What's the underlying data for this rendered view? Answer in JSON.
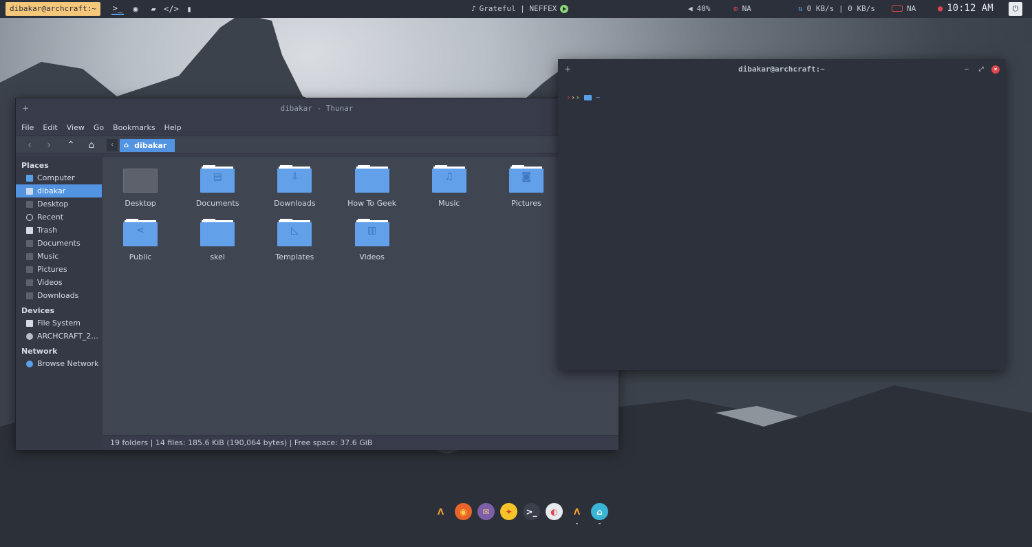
{
  "topbar": {
    "user": "dibakar@archcraft:~",
    "apps": [
      {
        "icon": "terminal-icon",
        "glyph": ">_"
      },
      {
        "icon": "firefox-icon",
        "glyph": "◉"
      },
      {
        "icon": "folder-open-icon",
        "glyph": "▰"
      },
      {
        "icon": "code-icon",
        "glyph": "</>"
      },
      {
        "icon": "book-icon",
        "glyph": "▮"
      }
    ],
    "music_note": "♪",
    "music": "Grateful | NEFFEX",
    "volume": "40%",
    "cpu": "NA",
    "network": "0 KB/s | 0 KB/s",
    "battery": "NA",
    "time": "10:12 AM"
  },
  "thunar": {
    "title": "dibakar - Thunar",
    "plus": "+",
    "menu": [
      "File",
      "Edit",
      "View",
      "Go",
      "Bookmarks",
      "Help"
    ],
    "path": "dibakar",
    "sidebar": {
      "places_heading": "Places",
      "places": [
        "Computer",
        "dibakar",
        "Desktop",
        "Recent",
        "Trash",
        "Documents",
        "Music",
        "Pictures",
        "Videos",
        "Downloads"
      ],
      "devices_heading": "Devices",
      "devices": [
        "File System",
        "ARCHCRAFT_2..."
      ],
      "network_heading": "Network",
      "network": [
        "Browse Network"
      ]
    },
    "folders": [
      {
        "name": "Desktop",
        "glyph": ""
      },
      {
        "name": "Documents",
        "glyph": "▤"
      },
      {
        "name": "Downloads",
        "glyph": "⇩"
      },
      {
        "name": "How To Geek",
        "glyph": ""
      },
      {
        "name": "Music",
        "glyph": "♫"
      },
      {
        "name": "Pictures",
        "glyph": "◙"
      },
      {
        "name": "Public",
        "glyph": "⋖"
      },
      {
        "name": "skel",
        "glyph": ""
      },
      {
        "name": "Templates",
        "glyph": "◺"
      },
      {
        "name": "Videos",
        "glyph": "▥"
      }
    ],
    "status": "19 folders  |  14 files: 185.6 KiB (190,064 bytes)  |  Free space: 37.6 GiB"
  },
  "terminal": {
    "title": "dibakar@archcraft:~",
    "plus": "+",
    "prompt_arrows": ">>>",
    "prompt_dir": "~"
  },
  "dock": [
    {
      "icon": "archcraft-icon",
      "glyph": "Λ",
      "bg": "#2b303a",
      "fg": "#f4a02a",
      "running": false
    },
    {
      "icon": "firefox-icon",
      "glyph": "◉",
      "bg": "#e8642b",
      "fg": "#ffd24a",
      "running": false
    },
    {
      "icon": "mail-icon",
      "glyph": "✉",
      "bg": "#7c5fa8",
      "fg": "#f4c77b",
      "running": false
    },
    {
      "icon": "geany-icon",
      "glyph": "✦",
      "bg": "#f4c42a",
      "fg": "#d23b2b",
      "running": false
    },
    {
      "icon": "terminal-icon",
      "glyph": ">_",
      "bg": "#3a3f4b",
      "fg": "#ffffff",
      "running": false
    },
    {
      "icon": "settings-toggle-icon",
      "glyph": "◐",
      "bg": "#e7eaee",
      "fg": "#e0474d",
      "running": false
    },
    {
      "icon": "archcraft-terminal-icon",
      "glyph": "Λ",
      "bg": "#2b303a",
      "fg": "#f4a02a",
      "running": true
    },
    {
      "icon": "home-folder-icon",
      "glyph": "⌂",
      "bg": "#3ab5d6",
      "fg": "#ffffff",
      "running": true
    }
  ]
}
